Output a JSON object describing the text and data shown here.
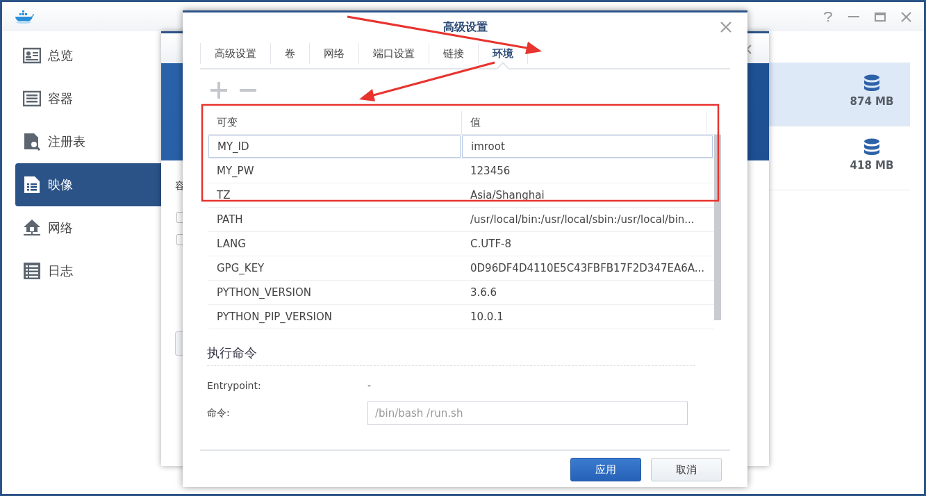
{
  "app": {
    "nav": [
      {
        "label": "总览",
        "kind": "overview",
        "selected": false
      },
      {
        "label": "容器",
        "kind": "container",
        "selected": false
      },
      {
        "label": "注册表",
        "kind": "registry",
        "selected": false
      },
      {
        "label": "映像",
        "kind": "image",
        "selected": true
      },
      {
        "label": "网络",
        "kind": "network",
        "selected": false
      },
      {
        "label": "日志",
        "kind": "log",
        "selected": false
      }
    ],
    "images": [
      {
        "size": "874 MB",
        "selected": true
      },
      {
        "size": "418 MB",
        "selected": false
      }
    ],
    "back_dialog": {
      "label": "容",
      "checkboxes": [
        {
          "checked": false
        },
        {
          "checked": false
        }
      ]
    }
  },
  "dialog": {
    "title": "高级设置",
    "tabs": [
      {
        "label": "高级设置",
        "selected": false
      },
      {
        "label": "卷",
        "selected": false
      },
      {
        "label": "网络",
        "selected": false
      },
      {
        "label": "端口设置",
        "selected": false
      },
      {
        "label": "链接",
        "selected": false
      },
      {
        "label": "环境",
        "selected": true
      }
    ],
    "table": {
      "columns": [
        "可变",
        "值"
      ],
      "rows": [
        {
          "name": "MY_ID",
          "value": "imroot",
          "editing": true
        },
        {
          "name": "MY_PW",
          "value": "123456",
          "editing": false
        },
        {
          "name": "TZ",
          "value": "Asia/Shanghai",
          "editing": false
        },
        {
          "name": "PATH",
          "value": "/usr/local/bin:/usr/local/sbin:/usr/local/bin...",
          "editing": false
        },
        {
          "name": "LANG",
          "value": "C.UTF-8",
          "editing": false
        },
        {
          "name": "GPG_KEY",
          "value": "0D96DF4D4110E5C43FBFB17F2D347EA6A...",
          "editing": false
        },
        {
          "name": "PYTHON_VERSION",
          "value": "3.6.6",
          "editing": false
        },
        {
          "name": "PYTHON_PIP_VERSION",
          "value": "10.0.1",
          "editing": false
        }
      ]
    },
    "command_section": {
      "title": "执行命令",
      "entrypoint_label": "Entrypoint:",
      "entrypoint_value": "-",
      "command_label": "命令:",
      "command_placeholder": "/bin/bash /run.sh"
    },
    "buttons": [
      {
        "label": "应用",
        "kind": "primary"
      },
      {
        "label": "取消",
        "kind": "secondary"
      }
    ]
  }
}
